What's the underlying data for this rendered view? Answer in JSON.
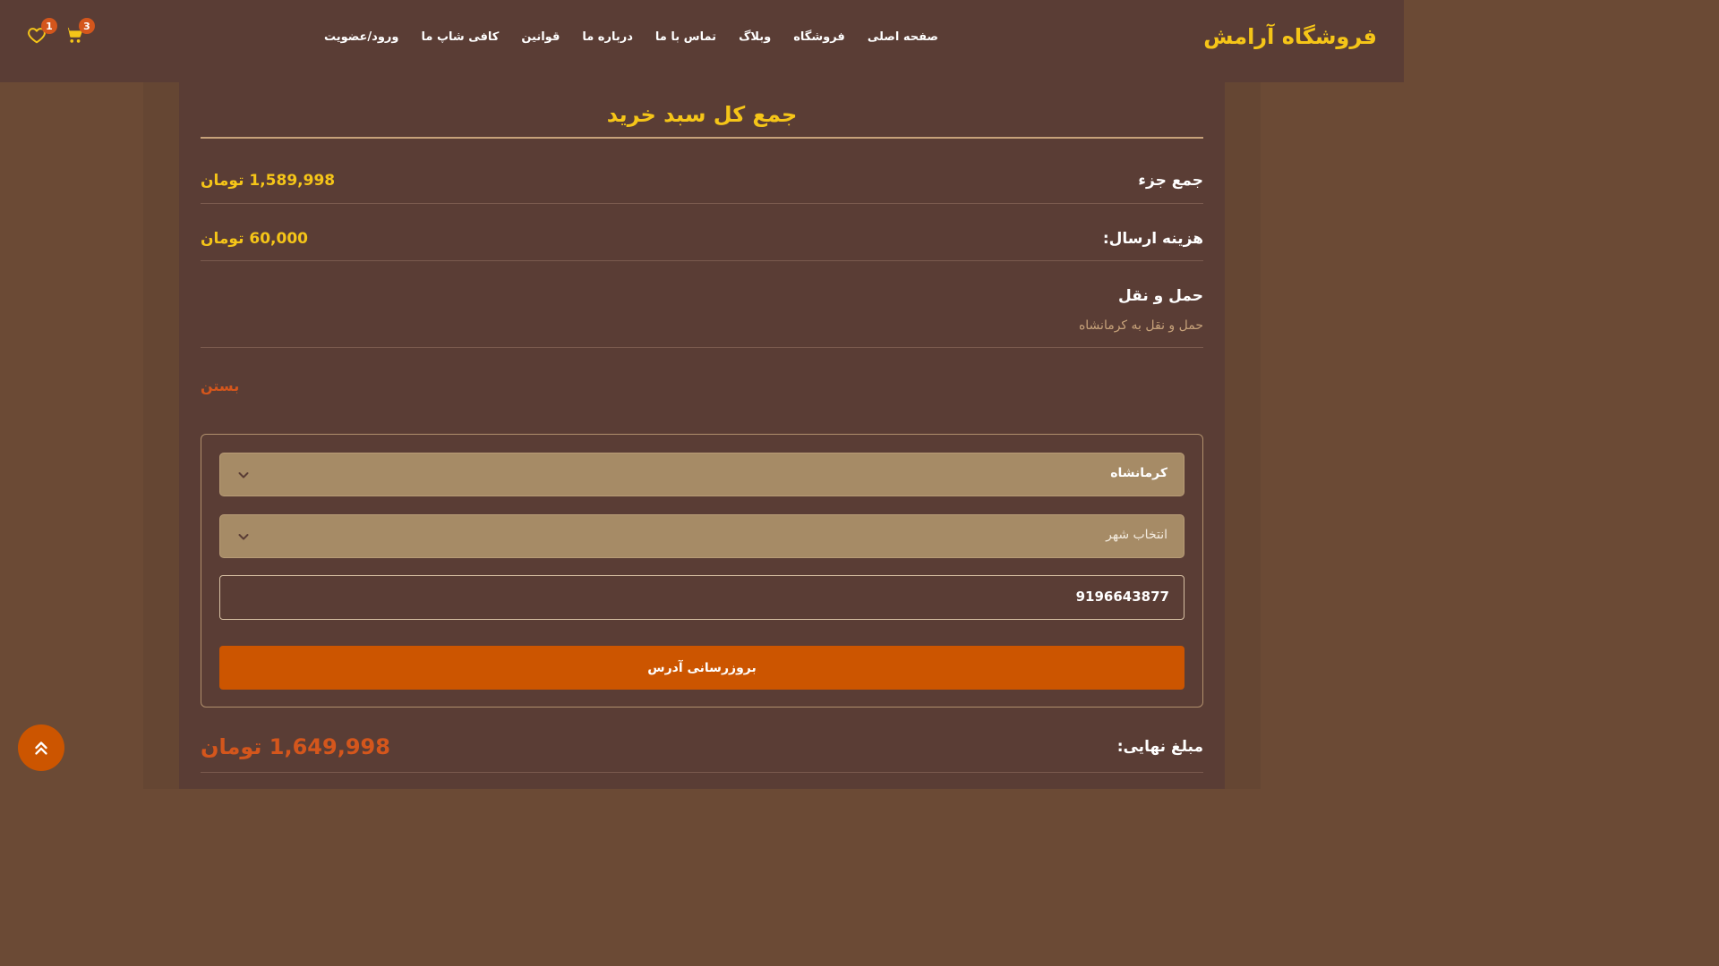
{
  "header": {
    "logo": "فروشگاه آرامش",
    "nav": [
      {
        "label": "صفحه اصلی"
      },
      {
        "label": "فروشگاه"
      },
      {
        "label": "وبلاگ"
      },
      {
        "label": "تماس با ما"
      },
      {
        "label": "درباره ما"
      },
      {
        "label": "قوانین"
      },
      {
        "label": "کافی شاپ ما"
      },
      {
        "label": "ورود/عضویت"
      }
    ],
    "cart_count": "3",
    "wishlist_count": "1",
    "icons": {
      "cart": "cart-icon",
      "wishlist": "heart-icon"
    }
  },
  "totals": {
    "title": "جمع کل سبد خرید",
    "subtotal_label": "جمع جزء",
    "subtotal_value": "1,589,998 تومان",
    "shipping_label": "هزینه ارسال:",
    "shipping_value": "60,000 تومان",
    "transport_label": "حمل و نقل",
    "transport_sub": "حمل و نقل به کرمانشاه",
    "close_label": "بستن",
    "final_label": "مبلغ نهایی:",
    "final_value": "1,649,998 تومان"
  },
  "address_form": {
    "province_value": "کرمانشاه",
    "city_placeholder": "انتخاب شهر",
    "postcode_value": "9196643877",
    "update_button": "بروزرسانی آدرس"
  },
  "colors": {
    "accent_yellow": "#f5c518",
    "accent_orange": "#cc5500",
    "panel_bg": "#5a3d35",
    "page_bg": "#6b4a35"
  }
}
